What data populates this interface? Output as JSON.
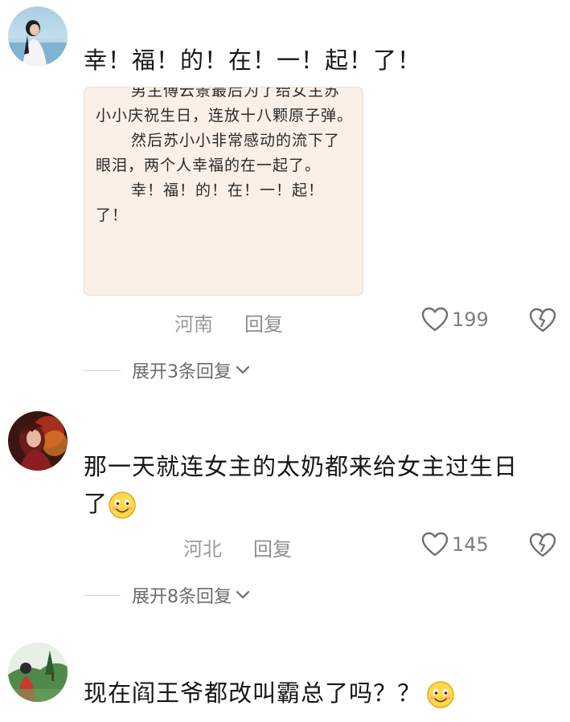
{
  "comments": [
    {
      "text_lines": [
        "幸！福！的！在！一！起！了！"
      ],
      "quote": {
        "paragraphs": [
          {
            "text": "男主傅云景最后为了给女主苏小小庆祝生日，连放十八颗原子弹。",
            "indent": true
          },
          {
            "text": "然后苏小小非常感动的流下了眼泪，两个人幸福的在一起了。",
            "indent": true
          },
          {
            "text": "幸！福！的！在！一！起！了！",
            "indent": true
          }
        ]
      },
      "location": "河南",
      "reply_label": "回复",
      "like_count": "199",
      "expand_label": "展开3条回复",
      "avatar": "avatar-seaside-girl"
    },
    {
      "text_lines": [
        "那一天就连女主的太奶都来给女主过生日",
        "了"
      ],
      "emoji": "smile-emoji",
      "location": "河北",
      "reply_label": "回复",
      "like_count": "145",
      "expand_label": "展开8条回复",
      "avatar": "avatar-red-anime"
    },
    {
      "text_lines": [
        "现在阎王爷都改叫霸总了吗？？"
      ],
      "emoji": "smile-emoji",
      "avatar": "avatar-green-outdoor"
    }
  ],
  "icons": {
    "like": "heart-outline-icon",
    "dislike": "broken-heart-icon",
    "expand": "chevron-down-icon"
  },
  "colors": {
    "quote_bg": "#fbf0e8",
    "meta": "#9a9a9a",
    "icon": "#6f6f6f",
    "emoji_face": "#ffd84d"
  }
}
